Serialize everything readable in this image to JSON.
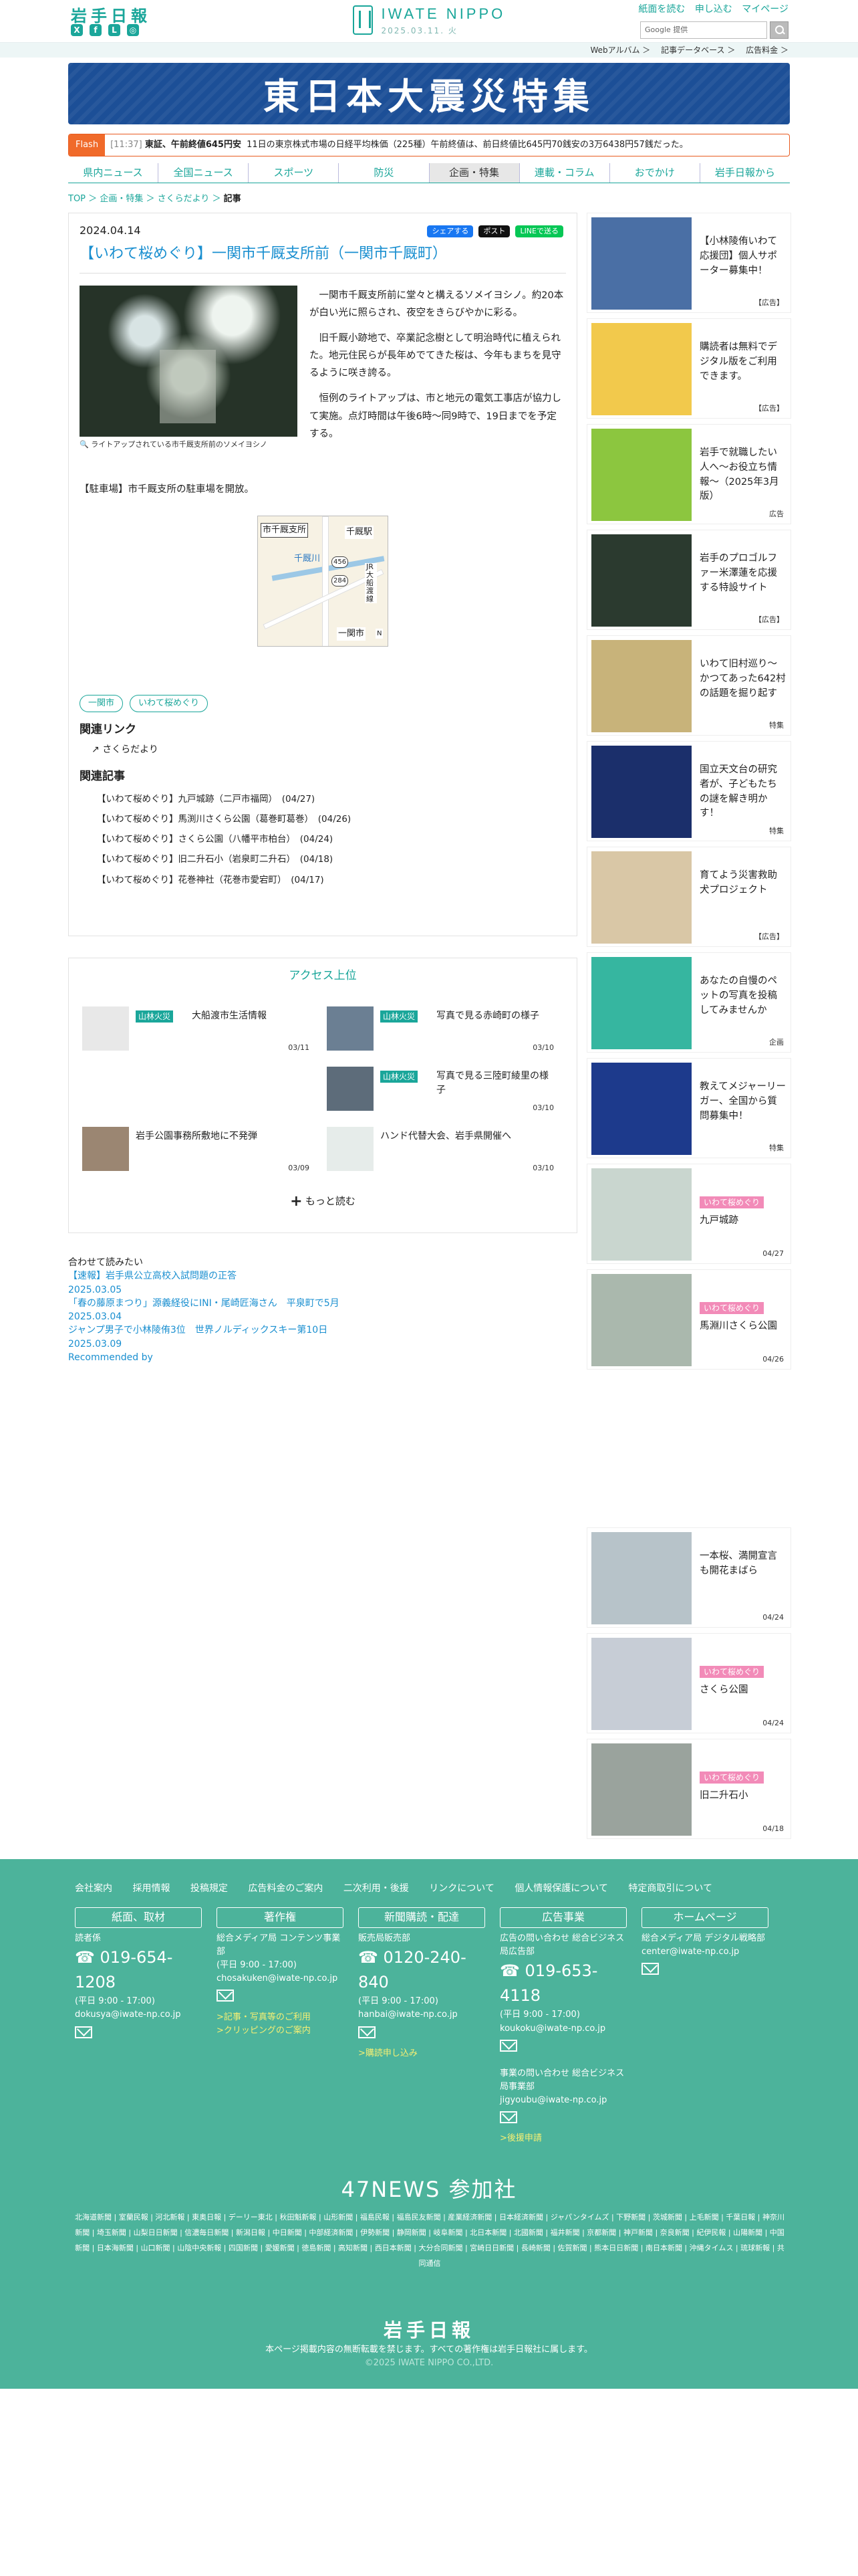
{
  "header": {
    "logo": "岩手日報",
    "center_brand": "IWATE NIPPO",
    "center_date": "2025.03.11. 火",
    "top_links": [
      "紙面を読む",
      "申し込む",
      "マイページ"
    ],
    "search_placeholder": "Google 提供",
    "subbar": [
      "Webアルバム ＞",
      "記事データベース ＞",
      "広告料金 ＞"
    ]
  },
  "banner": {
    "title": "東日本大震災特集"
  },
  "flash": {
    "label": "Flash",
    "time": "[11:37]",
    "bold": "東証、午前終値645円安",
    "text": "11日の東京株式市場の日経平均株価（225種）午前終値は、前日終値比645円70銭安の3万6438円57銭だった。"
  },
  "nav": [
    "県内ニュース",
    "全国ニュース",
    "スポーツ",
    "防災",
    "企画・特集",
    "連載・コラム",
    "おでかけ",
    "岩手日報から"
  ],
  "breadcrumb": {
    "top": "TOP",
    "sep": "＞",
    "cat": "企画・特集",
    "sub": "さくらだより",
    "current": "記事"
  },
  "article": {
    "date": "2024.04.14",
    "share": [
      "シェアする",
      "ポスト",
      "LINEで送る"
    ],
    "title": "【いわて桜めぐり】一関市千厩支所前（一関市千厩町）",
    "caption": "ライトアップされている市千厩支所前のソメイヨシノ",
    "paragraphs": [
      "一関市千厩支所前に堂々と構えるソメイヨシノ。約20本が白い光に照らされ、夜空をきらびやかに彩る。",
      "旧千厩小跡地で、卒業記念樹として明治時代に植えられた。地元住民らが長年めでてきた桜は、今年もまちを見守るように咲き誇る。",
      "恒例のライトアップは、市と地元の電気工事店が協力して実施。点灯時間は午後6時～同9時で、19日までを予定する。"
    ],
    "parking": "【駐車場】市千厩支所の駐車場を開放。",
    "map_labels": {
      "office": "市千厩支所",
      "station": "千厩駅",
      "river": "千厩川",
      "route1": "456",
      "route2": "284",
      "line": "JR大船渡線",
      "city": "一関市",
      "north": "N"
    },
    "tags": [
      "一関市",
      "いわて桜めぐり"
    ],
    "related_links_title": "関連リンク",
    "related_links": [
      "さくらだより"
    ],
    "related_articles_title": "関連記事",
    "related_articles": [
      "【いわて桜めぐり】九戸城跡（二戸市福岡）　(04/27)",
      "【いわて桜めぐり】馬渕川さくら公園（葛巻町葛巻）　(04/26)",
      "【いわて桜めぐり】さくら公園（八幡平市柏台）　(04/24)",
      "【いわて桜めぐり】旧二升石小（岩泉町二升石）　(04/18)",
      "【いわて桜めぐり】花巻神社（花巻市愛宕町）　(04/17)"
    ]
  },
  "access": {
    "title": "アクセス上位",
    "items": [
      {
        "cat": "山林火災",
        "title": "大船渡市生活情報",
        "date": "03/11"
      },
      {
        "cat": "山林火災",
        "title": "写真で見る赤崎町の様子",
        "date": "03/10"
      },
      {
        "cat": "山林火災",
        "title": "写真で見る三陸町綾里の様子",
        "date": "03/10"
      },
      {
        "cat": "",
        "title": "岩手公園事務所敷地に不発弾",
        "date": "03/09"
      },
      {
        "cat": "",
        "title": "ハンド代替大会、岩手県開催へ",
        "date": "03/10"
      }
    ],
    "more": "もっと読む"
  },
  "recommend": {
    "heading": "合わせて読みたい",
    "items": [
      {
        "title": "【速報】岩手県公立高校入試問題の正答",
        "date": "2025.03.05"
      },
      {
        "title": "「春の藤原まつり」源義経役にINI・尾崎匠海さん　平泉町で5月",
        "date": "2025.03.04"
      },
      {
        "title": "ジャンプ男子で小林陵侑3位　世界ノルディックスキー第10日",
        "date": "2025.03.09"
      }
    ],
    "recommended_by": "Recommended by"
  },
  "sidebar": {
    "cards": [
      {
        "title": "【小林陵侑いわて応援団】個人サポーター募集中！",
        "badge": "【広告】",
        "color": "#4a6fa5"
      },
      {
        "title": "購読者は無料でデジタル版をご利用できます。",
        "badge": "【広告】",
        "color": "#f2c94c"
      },
      {
        "title": "岩手で就職したい人へ～お役立ち情報～（2025年3月版）",
        "badge": "広告",
        "color": "#8cc63f"
      },
      {
        "title": "岩手のプロゴルファー米澤蓮を応援する特設サイト",
        "badge": "【広告】",
        "color": "#2b3a2f"
      },
      {
        "title": "いわて旧村巡り～かつてあった642村の話題を掘り起す",
        "badge": "特集",
        "color": "#c8b37a"
      },
      {
        "title": "国立天文台の研究者が、子どもたちの謎を解き明かす！",
        "badge": "特集",
        "color": "#1b2f6b"
      },
      {
        "title": "育てよう災害救助犬プロジェクト",
        "badge": "【広告】",
        "color": "#d9c7a6"
      },
      {
        "title": "あなたの自慢のペットの写真を投稿してみませんか",
        "badge": "企画",
        "color": "#36b6a0"
      },
      {
        "title": "教えてメジャーリーガー、全国から質問募集中！",
        "badge": "特集",
        "color": "#1d3a8c"
      }
    ],
    "sakura": [
      {
        "tag": "いわて桜めぐり",
        "title": "九戸城跡",
        "date": "04/27"
      },
      {
        "tag": "いわて桜めぐり",
        "title": "馬淵川さくら公園",
        "date": "04/26"
      },
      {
        "tag": "",
        "title": "一本桜、満開宣言も開花まばら",
        "date": "04/24"
      },
      {
        "tag": "いわて桜めぐり",
        "title": "さくら公園",
        "date": "04/24"
      },
      {
        "tag": "いわて桜めぐり",
        "title": "旧二升石小",
        "date": "04/18"
      }
    ]
  },
  "footer": {
    "links": [
      "会社案内",
      "採用情報",
      "投稿規定",
      "広告料金のご案内",
      "二次利用・後援",
      "リンクについて",
      "個人情報保護について",
      "特定商取引について"
    ],
    "cols": [
      {
        "head": "紙面、取材",
        "dept": "読者係",
        "tel": "019-654-1208",
        "hours": "(平日 9:00 - 17:00)",
        "mail": "dokusya@iwate-np.co.jp",
        "links": []
      },
      {
        "head": "著作権",
        "dept": "総合メディア局 コンテンツ事業部",
        "tel": "",
        "hours": "(平日 9:00 - 17:00)",
        "mail": "chosakuken@iwate-np.co.jp",
        "links": [
          ">記事・写真等のご利用",
          ">クリッピングのご案内"
        ]
      },
      {
        "head": "新聞購読・配達",
        "dept": "販売局販売部",
        "tel": "0120-240-840",
        "hours": "(平日 9:00 - 17:00)",
        "mail": "hanbai@iwate-np.co.jp",
        "links": [
          ">購読申し込み"
        ]
      },
      {
        "head": "広告事業",
        "dept": "広告の問い合わせ 総合ビジネス局広告部",
        "tel": "019-653-4118",
        "hours": "(平日 9:00 - 17:00)",
        "mail": "koukoku@iwate-np.co.jp",
        "dept2": "事業の問い合わせ 総合ビジネス局事業部",
        "mail2": "jigyoubu@iwate-np.co.jp",
        "links": [
          ">後援申請"
        ]
      },
      {
        "head": "ホームページ",
        "dept": "総合メディア局 デジタル戦略部",
        "tel": "",
        "hours": "",
        "mail": "center@iwate-np.co.jp",
        "links": []
      }
    ],
    "news47": "47NEWS 参加社",
    "papers": "北海道新聞 | 室蘭民報 | 河北新報 | 東奥日報 | デーリー東北 | 秋田魁新報 | 山形新聞 | 福島民報 | 福島民友新聞 | 産業経済新聞 | 日本経済新聞 | ジャパンタイムズ | 下野新聞 | 茨城新聞 | 上毛新聞 | 千葉日報 | 神奈川新聞 | 埼玉新聞 | 山梨日日新聞 | 信濃毎日新聞 | 新潟日報 | 中日新聞 | 中部経済新聞 | 伊勢新聞 | 静岡新聞 | 岐阜新聞 | 北日本新聞 | 北國新聞 | 福井新聞 | 京都新聞 | 神戸新聞 | 奈良新聞 | 紀伊民報 | 山陽新聞 | 中国新聞 | 日本海新聞 | 山口新聞 | 山陰中央新報 | 四国新聞 | 愛媛新聞 | 徳島新聞 | 高知新聞 | 西日本新聞 | 大分合同新聞 | 宮崎日日新聞 | 長崎新聞 | 佐賀新聞 | 熊本日日新聞 | 南日本新聞 | 沖縄タイムス | 琉球新報 | 共同通信",
    "logo": "岩手日報",
    "note": "本ページ掲載内容の無断転載を禁じます。すべての著作権は岩手日報社に属します。",
    "copy": "©2025 IWATE NIPPO CO.,LTD."
  }
}
